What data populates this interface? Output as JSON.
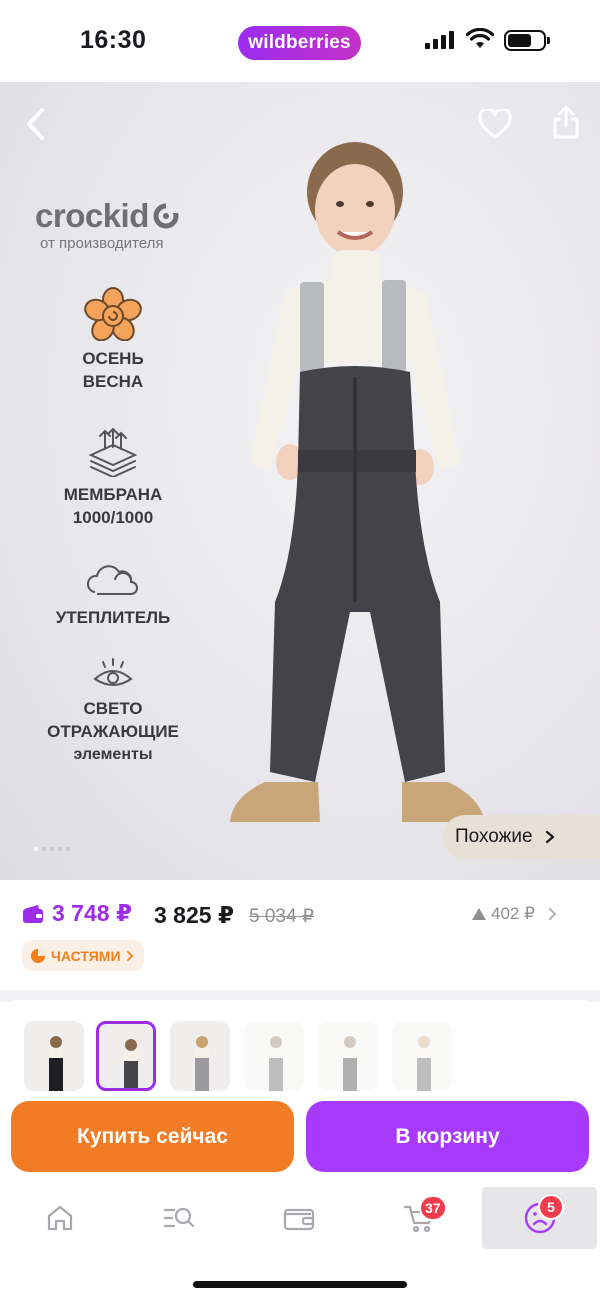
{
  "status_bar": {
    "time": "16:30",
    "store_badge": "wildberries"
  },
  "product": {
    "brand": "crockid",
    "brand_subtitle": "от производителя",
    "features": [
      {
        "line1": "ОСЕНЬ",
        "line2": "ВЕСНА",
        "icon": "flower-icon"
      },
      {
        "line1": "МЕМБРАНА",
        "line2": "1000/1000",
        "icon": "membrane-icon"
      },
      {
        "line1": "УТЕПЛИТЕЛЬ",
        "line2": "",
        "icon": "cloud-icon"
      },
      {
        "line1": "СВЕТО",
        "line2": "ОТРАЖАЮЩИЕ",
        "line3": "элементы",
        "icon": "eye-icon"
      }
    ],
    "similar_label": "Похожие",
    "gallery_total": 5,
    "gallery_active": 1
  },
  "price": {
    "wallet_price": "3 748 ₽",
    "regular_price": "3 825 ₽",
    "old_price": "5 034 ₽",
    "price_drop": "402 ₽",
    "installments_label": "ЧАСТЯМИ"
  },
  "variants": {
    "count": 6,
    "selected_index": 1
  },
  "actions": {
    "buy_now": "Купить сейчас",
    "add_to_cart": "В корзину"
  },
  "tabbar": {
    "cart_badge": "37",
    "profile_badge": "5"
  },
  "colors": {
    "accent_purple": "#a73afd",
    "buy_orange": "#f27c26",
    "badge_red": "#f23b4d",
    "installments_orange": "#f07e1b"
  }
}
